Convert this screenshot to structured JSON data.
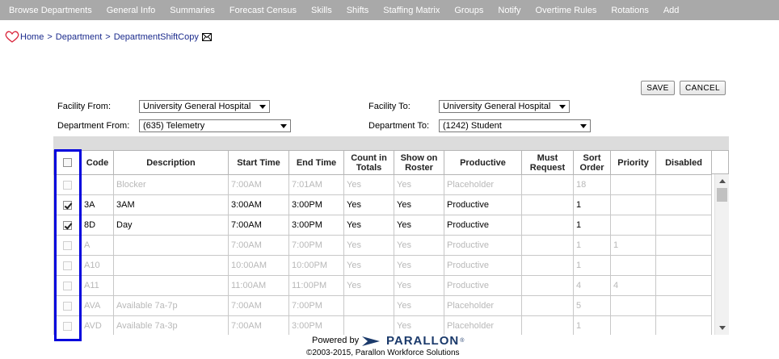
{
  "nav": {
    "items": [
      "Browse Departments",
      "General Info",
      "Summaries",
      "Forecast Census",
      "Skills",
      "Shifts",
      "Staffing Matrix",
      "Groups",
      "Notify",
      "Overtime Rules",
      "Rotations",
      "Add"
    ]
  },
  "breadcrumb": {
    "home": "Home",
    "sep1": ">",
    "department": "Department",
    "sep2": ">",
    "current": "DepartmentShiftCopy"
  },
  "actions": {
    "save": "SAVE",
    "cancel": "CANCEL"
  },
  "form": {
    "facility_from_label": "Facility From:",
    "facility_from_value": "University General Hospital",
    "facility_to_label": "Facility To:",
    "facility_to_value": "University General Hospital",
    "department_from_label": "Department From:",
    "department_from_value": "(635) Telemetry",
    "department_to_label": "Department To:",
    "department_to_value": "(1242) Student"
  },
  "table": {
    "headers": [
      "",
      "Code",
      "Description",
      "Start Time",
      "End Time",
      "Count in Totals",
      "Show on Roster",
      "Productive",
      "Must Request",
      "Sort Order",
      "Priority",
      "Disabled"
    ],
    "rows": [
      {
        "checked": false,
        "dim": true,
        "code": "",
        "description": "Blocker",
        "start": "7:00AM",
        "end": "7:01AM",
        "count": "Yes",
        "roster": "Yes",
        "productive": "Placeholder",
        "must": "",
        "sort": "18",
        "priority": "",
        "disabled": ""
      },
      {
        "checked": true,
        "dim": false,
        "code": "3A",
        "description": "3AM",
        "start": "3:00AM",
        "end": "3:00PM",
        "count": "Yes",
        "roster": "Yes",
        "productive": "Productive",
        "must": "",
        "sort": "1",
        "priority": "",
        "disabled": ""
      },
      {
        "checked": true,
        "dim": false,
        "code": "8D",
        "description": "Day",
        "start": "7:00AM",
        "end": "3:00PM",
        "count": "Yes",
        "roster": "Yes",
        "productive": "Productive",
        "must": "",
        "sort": "1",
        "priority": "",
        "disabled": ""
      },
      {
        "checked": false,
        "dim": true,
        "code": "A",
        "description": "",
        "start": "7:00AM",
        "end": "7:00PM",
        "count": "Yes",
        "roster": "Yes",
        "productive": "Productive",
        "must": "",
        "sort": "1",
        "priority": "1",
        "disabled": ""
      },
      {
        "checked": false,
        "dim": true,
        "code": "A10",
        "description": "",
        "start": "10:00AM",
        "end": "10:00PM",
        "count": "Yes",
        "roster": "Yes",
        "productive": "Productive",
        "must": "",
        "sort": "1",
        "priority": "",
        "disabled": ""
      },
      {
        "checked": false,
        "dim": true,
        "code": "A11",
        "description": "",
        "start": "11:00AM",
        "end": "11:00PM",
        "count": "Yes",
        "roster": "Yes",
        "productive": "Productive",
        "must": "",
        "sort": "4",
        "priority": "4",
        "disabled": ""
      },
      {
        "checked": false,
        "dim": true,
        "code": "AVA",
        "description": "Available 7a-7p",
        "start": "7:00AM",
        "end": "7:00PM",
        "count": "",
        "roster": "Yes",
        "productive": "Placeholder",
        "must": "",
        "sort": "5",
        "priority": "",
        "disabled": ""
      },
      {
        "checked": false,
        "dim": true,
        "code": "AVD",
        "description": "Available 7a-3p",
        "start": "7:00AM",
        "end": "3:00PM",
        "count": "",
        "roster": "Yes",
        "productive": "Placeholder",
        "must": "",
        "sort": "1",
        "priority": "",
        "disabled": ""
      }
    ]
  },
  "footer": {
    "powered_by": "Powered by",
    "brand": "PARALLON",
    "reg": "®",
    "copyright": "©2003-2015, Parallon Workforce Solutions"
  },
  "colors": {
    "nav_bg": "#a9a9a9",
    "link": "#1a2a8c",
    "highlight": "#0000dd",
    "brand": "#1b3a6b"
  },
  "icons": [
    "heart-icon",
    "mail-icon",
    "checkbox-icon",
    "dropdown-caret-icon",
    "parallon-logo-icon",
    "scroll-up-icon",
    "scroll-down-icon"
  ]
}
